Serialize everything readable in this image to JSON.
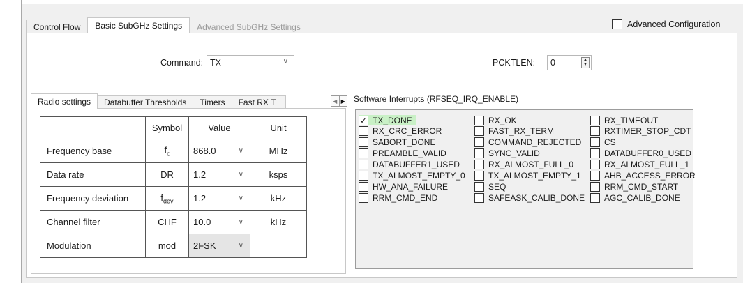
{
  "main_tabs": [
    "Control Flow",
    "Basic SubGHz Settings",
    "Advanced SubGHz Settings"
  ],
  "advanced_configuration": {
    "label": "Advanced Configuration",
    "checked": false
  },
  "command": {
    "label": "Command:",
    "value": "TX"
  },
  "pcklen": {
    "label": "PCKTLEN:",
    "value": "0"
  },
  "sub_tabs": [
    "Radio settings",
    "Databuffer Thresholds",
    "Timers",
    "Fast RX T"
  ],
  "radio_table": {
    "headers": {
      "name": "",
      "symbol": "Symbol",
      "value": "Value",
      "unit": "Unit"
    },
    "rows": [
      {
        "name": "Frequency base",
        "symbol": "f",
        "symbol_sub": "c",
        "value": "868.0",
        "unit": "MHz"
      },
      {
        "name": "Data rate",
        "symbol": "DR",
        "symbol_sub": "",
        "value": "1.2",
        "unit": "ksps"
      },
      {
        "name": "Frequency deviation",
        "symbol": "f",
        "symbol_sub": "dev",
        "value": "1.2",
        "unit": "kHz"
      },
      {
        "name": "Channel filter",
        "symbol": "CHF",
        "symbol_sub": "",
        "value": "10.0",
        "unit": "kHz"
      },
      {
        "name": "Modulation",
        "symbol": "mod",
        "symbol_sub": "",
        "value": "2FSK",
        "unit": ""
      }
    ]
  },
  "software_interrupts": {
    "title": "Software Interrupts (RFSEQ_IRQ_ENABLE)",
    "highlight_color": "#c9f0c6",
    "columns": [
      [
        {
          "label": "TX_DONE",
          "checked": true
        },
        {
          "label": "RX_CRC_ERROR",
          "checked": false
        },
        {
          "label": "SABORT_DONE",
          "checked": false
        },
        {
          "label": "PREAMBLE_VALID",
          "checked": false
        },
        {
          "label": "DATABUFFER1_USED",
          "checked": false
        },
        {
          "label": "TX_ALMOST_EMPTY_0",
          "checked": false
        },
        {
          "label": "HW_ANA_FAILURE",
          "checked": false
        },
        {
          "label": "RRM_CMD_END",
          "checked": false
        }
      ],
      [
        {
          "label": "RX_OK",
          "checked": false
        },
        {
          "label": "FAST_RX_TERM",
          "checked": false
        },
        {
          "label": "COMMAND_REJECTED",
          "checked": false
        },
        {
          "label": "SYNC_VALID",
          "checked": false
        },
        {
          "label": "RX_ALMOST_FULL_0",
          "checked": false
        },
        {
          "label": "TX_ALMOST_EMPTY_1",
          "checked": false
        },
        {
          "label": "SEQ",
          "checked": false
        },
        {
          "label": "SAFEASK_CALIB_DONE",
          "checked": false
        }
      ],
      [
        {
          "label": "RX_TIMEOUT",
          "checked": false
        },
        {
          "label": "RXTIMER_STOP_CDT",
          "checked": false
        },
        {
          "label": "CS",
          "checked": false
        },
        {
          "label": "DATABUFFER0_USED",
          "checked": false
        },
        {
          "label": "RX_ALMOST_FULL_1",
          "checked": false
        },
        {
          "label": "AHB_ACCESS_ERROR",
          "checked": false
        },
        {
          "label": "RRM_CMD_START",
          "checked": false
        },
        {
          "label": "AGC_CALIB_DONE",
          "checked": false
        }
      ]
    ]
  }
}
